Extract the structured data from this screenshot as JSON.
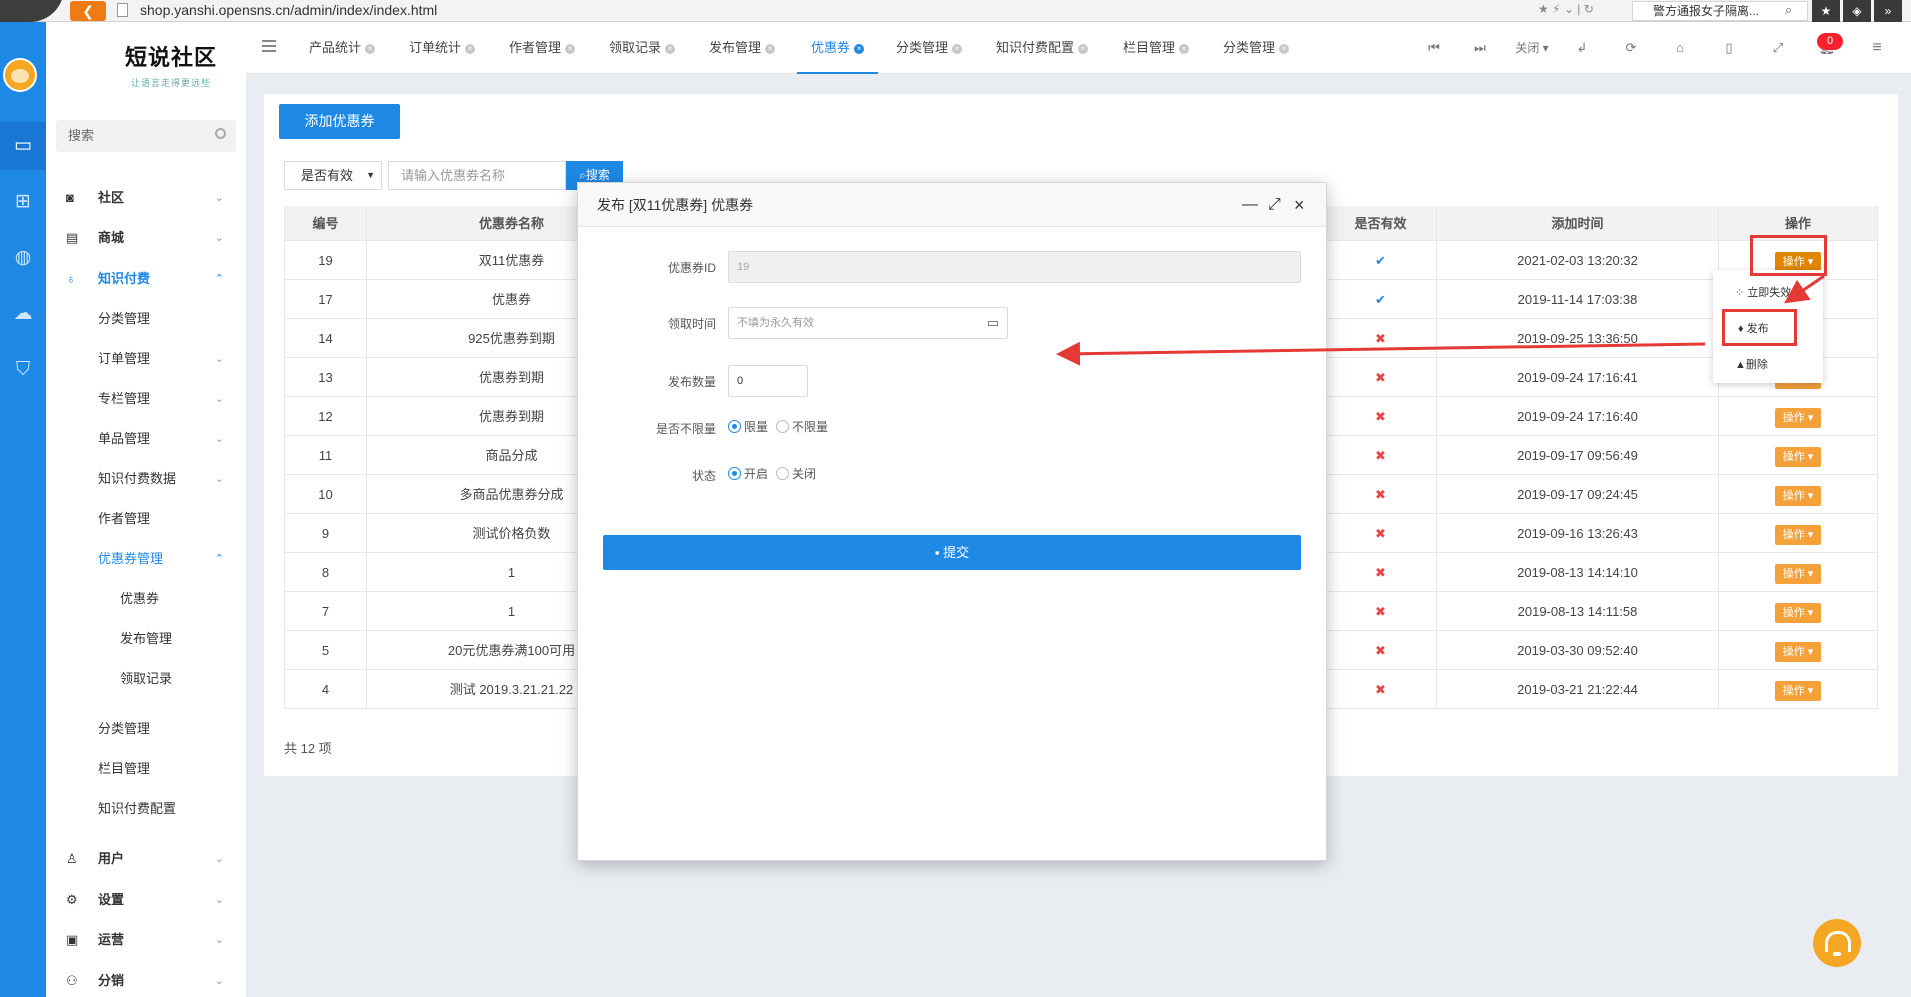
{
  "browser": {
    "url": "shop.yanshi.opensns.cn/admin/index/index.html",
    "search_text": "警方通报女子隔离..."
  },
  "brand": {
    "title": "短说社区",
    "subtitle": "让语言走得更远些"
  },
  "sidebar": {
    "search_placeholder": "搜索",
    "menu": [
      {
        "label": "社区",
        "icon": "community-icon"
      },
      {
        "label": "商城",
        "icon": "shop-icon"
      },
      {
        "label": "知识付费",
        "icon": "bulb-icon"
      },
      {
        "label": "分类管理"
      },
      {
        "label": "订单管理"
      },
      {
        "label": "专栏管理"
      },
      {
        "label": "单品管理"
      },
      {
        "label": "知识付费数据"
      },
      {
        "label": "作者管理"
      },
      {
        "label": "优惠券管理"
      },
      {
        "label": "优惠券"
      },
      {
        "label": "发布管理"
      },
      {
        "label": "领取记录"
      },
      {
        "label": "分类管理"
      },
      {
        "label": "栏目管理"
      },
      {
        "label": "知识付费配置"
      },
      {
        "label": "用户",
        "icon": "user-icon"
      },
      {
        "label": "设置",
        "icon": "settings-icon"
      },
      {
        "label": "运营",
        "icon": "operation-icon"
      },
      {
        "label": "分销",
        "icon": "distribution-icon"
      }
    ]
  },
  "tabs": [
    {
      "label": "产品统计"
    },
    {
      "label": "订单统计"
    },
    {
      "label": "作者管理"
    },
    {
      "label": "领取记录"
    },
    {
      "label": "发布管理"
    },
    {
      "label": "优惠券"
    },
    {
      "label": "分类管理"
    },
    {
      "label": "知识付费配置"
    },
    {
      "label": "栏目管理"
    },
    {
      "label": "分类管理"
    }
  ],
  "topbar": {
    "close_label": "关闭",
    "notification_count": "0"
  },
  "toolbar": {
    "add_button": "添加优惠券",
    "filter_select": "是否有效",
    "search_placeholder": "请输入优惠券名称",
    "search_button": "搜索"
  },
  "table": {
    "headers": [
      "编号",
      "优惠券名称",
      "是否有效",
      "添加时间",
      "操作"
    ],
    "op_label": "操作",
    "rows": [
      {
        "id": "19",
        "name": "双11优惠券",
        "valid": true,
        "time": "2021-02-03 13:20:32"
      },
      {
        "id": "17",
        "name": "优惠券",
        "valid": true,
        "time": "2019-11-14 17:03:38"
      },
      {
        "id": "14",
        "name": "925优惠券到期",
        "valid": false,
        "time": "2019-09-25 13:36:50"
      },
      {
        "id": "13",
        "name": "优惠券到期",
        "valid": false,
        "time": "2019-09-24 17:16:41"
      },
      {
        "id": "12",
        "name": "优惠券到期",
        "valid": false,
        "time": "2019-09-24 17:16:40"
      },
      {
        "id": "11",
        "name": "商品分成",
        "valid": false,
        "time": "2019-09-17 09:56:49"
      },
      {
        "id": "10",
        "name": "多商品优惠券分成",
        "valid": false,
        "time": "2019-09-17 09:24:45"
      },
      {
        "id": "9",
        "name": "测试价格负数",
        "valid": false,
        "time": "2019-09-16 13:26:43"
      },
      {
        "id": "8",
        "name": "1",
        "valid": false,
        "time": "2019-08-13 14:14:10"
      },
      {
        "id": "7",
        "name": "1",
        "valid": false,
        "time": "2019-08-13 14:11:58"
      },
      {
        "id": "5",
        "name": "20元优惠券满100可用",
        "valid": false,
        "time": "2019-03-30 09:52:40"
      },
      {
        "id": "4",
        "name": "测试 2019.3.21.21.22",
        "valid": false,
        "time": "2019-03-21 21:22:44"
      }
    ],
    "total": "共 12 项"
  },
  "dropdown": {
    "items": [
      "立即失效",
      "发布",
      "删除"
    ]
  },
  "modal": {
    "title": "发布 [双11优惠券] 优惠券",
    "coupon_id_label": "优惠券ID",
    "coupon_id_value": "19",
    "time_label": "领取时间",
    "time_placeholder": "不填为永久有效",
    "count_label": "发布数量",
    "count_value": "0",
    "limit_label": "是否不限量",
    "limit_options": [
      "限量",
      "不限量"
    ],
    "status_label": "状态",
    "status_options": [
      "开启",
      "关闭"
    ],
    "submit_label": "提交"
  },
  "colors": {
    "primary": "#1e88e5",
    "warning": "#f5a13a",
    "danger": "#e53935"
  }
}
